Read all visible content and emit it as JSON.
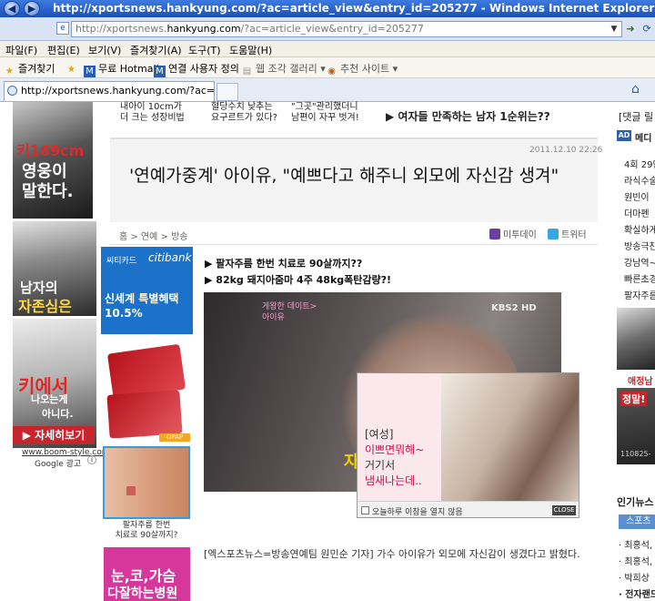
{
  "window": {
    "title": "http://xportsnews.hankyung.com/?ac=article_view&entry_id=205277 - Windows Internet Explorer",
    "back_icon": "back-arrow-icon",
    "forward_icon": "forward-arrow-icon"
  },
  "address": {
    "prefix": "http://xportsnews.",
    "domain": "hankyung.com",
    "suffix": "/?ac=article_view&entry_id=205277"
  },
  "menu": [
    "파일(F)",
    "편집(E)",
    "보기(V)",
    "즐겨찾기(A)",
    "도구(T)",
    "도움말(H)"
  ],
  "favorites": {
    "label": "즐겨찾기",
    "items": [
      "무료 Hotmail",
      "연결 사용자 정의",
      "웹 조각 갤러리 ▾",
      "추천 사이트 ▾"
    ]
  },
  "tab": {
    "label": "http://xportsnews.hankyung.com/?ac=article..."
  },
  "left_ads": {
    "ad1_line1": "키169cm",
    "ad1_line2": "영웅이",
    "ad1_line3": "말한다.",
    "ad2_line1": "남자의",
    "ad2_line2": "자존심은",
    "ad3_line1": "키에서",
    "ad3_line2": "나오는게",
    "ad3_line3": "아니다.",
    "detail_button": "▶ 자세히보기",
    "url": "www.boom-style.com/",
    "google": "Google 광고"
  },
  "top_news": {
    "item1_l1": "내아이 10cm가",
    "item1_l2": "더 크는 성장비법",
    "item2_l1": "혈당수치 낮추는",
    "item2_l2": "요구르트가 있다?",
    "item3_l1": "\"그곳\"관리했더니",
    "item3_l2": "남편이 자꾸 벗겨!",
    "headline": "▶ 여자들 만족하는 남자 1순위는??"
  },
  "article": {
    "date": "2011.12.10 22:26",
    "title": "'연예가중계' 아이유, \"예쁘다고 해주니 외모에 자신감 생겨\"",
    "breadcrumb": "홈 > 연예 > 방송",
    "share_metoday": "미투데이",
    "share_twitter": "트위터",
    "link1": "▶ 팔자주름 한번 치료로 90살까지??",
    "link2": "▶ 82kg 돼지아줌마 4주 48kg폭탄감량?!",
    "body": "[엑스포츠뉴스=방송연예팀 원민순 기자] 가수 아이유가 외모에 자신감이 생겼다고 밝혔다."
  },
  "video": {
    "badge": "KBS2 HD",
    "caption_l1": "게왕한 데이트>",
    "caption_l2": "아이유",
    "subtitle_fragment": "자"
  },
  "citi_ad": {
    "label": "씨티카드",
    "brand": "citibank",
    "line1": "신세계 특별혜택",
    "line2": "10.5%"
  },
  "small_ads": {
    "opap": "OPAP",
    "nose_caption_l1": "팔자주름 한번",
    "nose_caption_l2": "치료로 90살까지?",
    "pink_l1": "눈,코,가슴",
    "pink_l2": "다잘하는병원"
  },
  "popup": {
    "tag": "[여성]",
    "line1": "이쁘면뭐해~",
    "line2": "거기서",
    "line3": "냄새나는데..",
    "checkbox": "오늘하루 이창을 열지 않음",
    "close": "CLOSE"
  },
  "right_sidebar": {
    "top": "[댓글 릴",
    "ad_badge": "AD",
    "ad_label": "메디",
    "items": [
      "4회 29만",
      "라식수술",
      "원빈이 ",
      "더마펜 ",
      "확실하게",
      "방송극찬",
      "강남역~",
      "빠른초경",
      "팔자주름"
    ],
    "model_caption": "애정남",
    "promo": "정말!",
    "number": "110825-",
    "popular": "인기뉴스",
    "sports_tab": "스포츠",
    "list": [
      "· 최홍석, ",
      "· 최홍석, ",
      "· 박희상 ",
      "· 전자랜드"
    ]
  },
  "colors": {
    "title_bar": "#1a4fc0",
    "red_accent": "#c7252c",
    "citi_blue": "#1b72c8",
    "popup_pink": "#c0144a"
  }
}
